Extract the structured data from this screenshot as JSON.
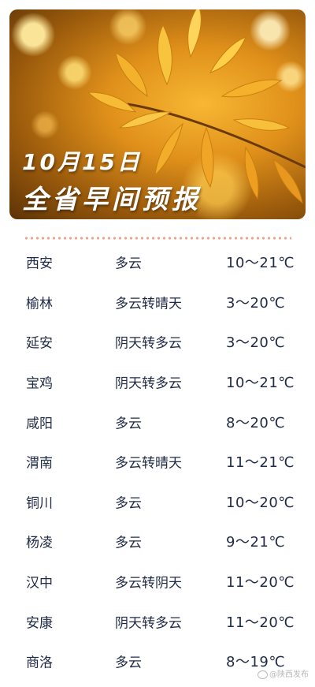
{
  "banner": {
    "date": "10月15日",
    "title": "全省早间预报"
  },
  "forecast": [
    {
      "city": "西安",
      "weather": "多云",
      "temp": "10～21℃"
    },
    {
      "city": "榆林",
      "weather": "多云转晴天",
      "temp": "3～20℃"
    },
    {
      "city": "延安",
      "weather": "阴天转多云",
      "temp": "3～20℃"
    },
    {
      "city": "宝鸡",
      "weather": "阴天转多云",
      "temp": "10～21℃"
    },
    {
      "city": "咸阳",
      "weather": "多云",
      "temp": "8～20℃"
    },
    {
      "city": "渭南",
      "weather": "多云转晴天",
      "temp": "11～21℃"
    },
    {
      "city": "铜川",
      "weather": "多云",
      "temp": "10～20℃"
    },
    {
      "city": "杨凌",
      "weather": "多云",
      "temp": "9～21℃"
    },
    {
      "city": "汉中",
      "weather": "多云转阴天",
      "temp": "11～20℃"
    },
    {
      "city": "安康",
      "weather": "阴天转多云",
      "temp": "11～20℃"
    },
    {
      "city": "商洛",
      "weather": "多云",
      "temp": "8～19℃"
    }
  ],
  "watermark": "@陕西发布",
  "colors": {
    "text": "#1f2a44",
    "divider_dots": "#e9a48b",
    "banner_primary": "#e0901a"
  }
}
